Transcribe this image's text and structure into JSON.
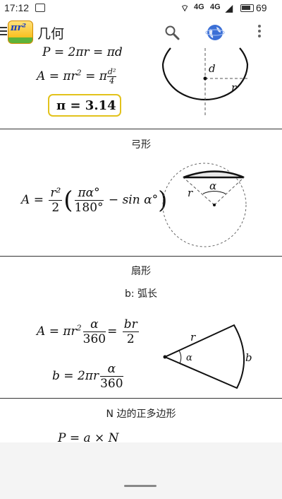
{
  "status_bar": {
    "time": "17:12",
    "network_1": "4G",
    "network_2": "4G",
    "battery": "69"
  },
  "app_bar": {
    "logo_text": "πr²",
    "title": "几何",
    "icons": [
      "menu-icon",
      "search-icon",
      "globe-icon",
      "more-icon"
    ]
  },
  "circle": {
    "perimeter": {
      "lhs": "P",
      "mid": "2πr",
      "rhs": "πd"
    },
    "area": {
      "lhs": "A",
      "mid": "πr",
      "exp": "2",
      "rhs_pre": "π",
      "num": "d²",
      "den": "4"
    },
    "pi_value": "π = 3.14",
    "labels": {
      "d": "d",
      "r": "r"
    }
  },
  "segment": {
    "heading": "弓形",
    "formula": {
      "lhs": "A",
      "frac_num": "r²",
      "frac_den": "2",
      "inner_num": "πα°",
      "inner_den": "180°",
      "tail": "sin α°"
    },
    "labels": {
      "r": "r",
      "alpha": "α"
    }
  },
  "sector": {
    "heading": "扇形",
    "subheading": "b: 弧长",
    "area": {
      "lhs": "A",
      "mid": "πr",
      "exp": "2",
      "num1": "α",
      "den1": "360",
      "num2": "br",
      "den2": "2"
    },
    "arc": {
      "lhs": "b",
      "mid": "2πr",
      "num": "α",
      "den": "360"
    },
    "labels": {
      "r": "r",
      "alpha": "α",
      "b": "b"
    }
  },
  "polygon": {
    "heading": "N 边的正多边形",
    "formula": "P = a × N"
  }
}
